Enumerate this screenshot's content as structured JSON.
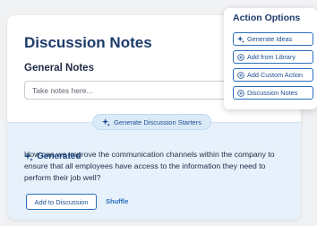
{
  "card": {
    "title": "Discussion Notes",
    "subtitle": "General Notes",
    "notes_placeholder": "Take notes here..."
  },
  "generator": {
    "button_label": "Generate Discussion Starters",
    "generated_label": "Generated",
    "generated_text": "How can we improve the communication channels within the company to ensure that all employees have access to the information they need to perform their job well?",
    "add_button_label": "Add to Discussion",
    "shuffle_label": "Shuffle"
  },
  "action_options": {
    "title": "Action Options",
    "items": [
      {
        "label": "Generate Ideas",
        "icon": "sparkle-icon"
      },
      {
        "label": "Add from Library",
        "icon": "plus-circle-icon"
      },
      {
        "label": "Add Custom Action",
        "icon": "plus-circle-icon"
      },
      {
        "label": "Discussion Notes",
        "icon": "plus-circle-icon"
      }
    ]
  },
  "colors": {
    "brand_navy": "#1d3b6b",
    "accent_blue": "#2a6ebd",
    "panel_light_blue": "#e6f1fb"
  }
}
